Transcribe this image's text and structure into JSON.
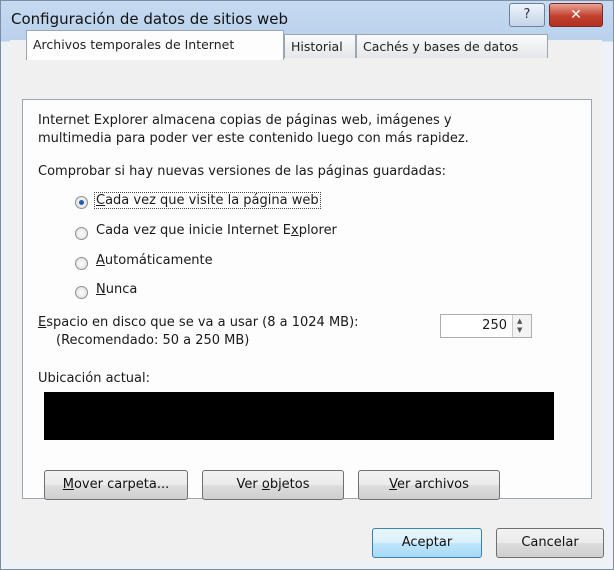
{
  "window": {
    "title": "Configuración de datos de sitios web",
    "help_label": "?",
    "close_label": "✕"
  },
  "tabs": [
    {
      "label": "Archivos temporales de Internet",
      "active": true
    },
    {
      "label": "Historial",
      "active": false
    },
    {
      "label": "Cachés y bases de datos",
      "active": false
    }
  ],
  "temp_files": {
    "description_line1": "Internet Explorer almacena copias de páginas web, imágenes y",
    "description_line2": "multimedia para poder ver este contenido luego con más rapidez.",
    "check_label": "Comprobar si hay nuevas versiones de las páginas guardadas:",
    "options": [
      {
        "accel": "C",
        "rest": "ada vez que visite la página web",
        "checked": true
      },
      {
        "pre": "Cada vez que inicie Internet E",
        "accel": "x",
        "rest": "plorer",
        "checked": false
      },
      {
        "accel": "A",
        "rest": "utomáticamente",
        "checked": false
      },
      {
        "accel": "N",
        "rest": "unca",
        "checked": false
      }
    ],
    "disk_space_accel": "E",
    "disk_space_label": "spacio en disco que se va a usar (8 a 1024 MB):",
    "recommended": "(Recomendado: 50 a 250 MB)",
    "disk_space_value": "250",
    "location_label": "Ubicación actual:"
  },
  "buttons": {
    "move_accel": "M",
    "move_rest": "over carpeta...",
    "objects_pre": "Ver ",
    "objects_accel": "o",
    "objects_rest": "bjetos",
    "files_accel": "V",
    "files_rest": "er archivos",
    "ok": "Aceptar",
    "cancel": "Cancelar"
  },
  "colors": {
    "radio_checked": "#1e5fb4",
    "close_button": "#c3402f",
    "title_bar": "#c6dbf1"
  }
}
